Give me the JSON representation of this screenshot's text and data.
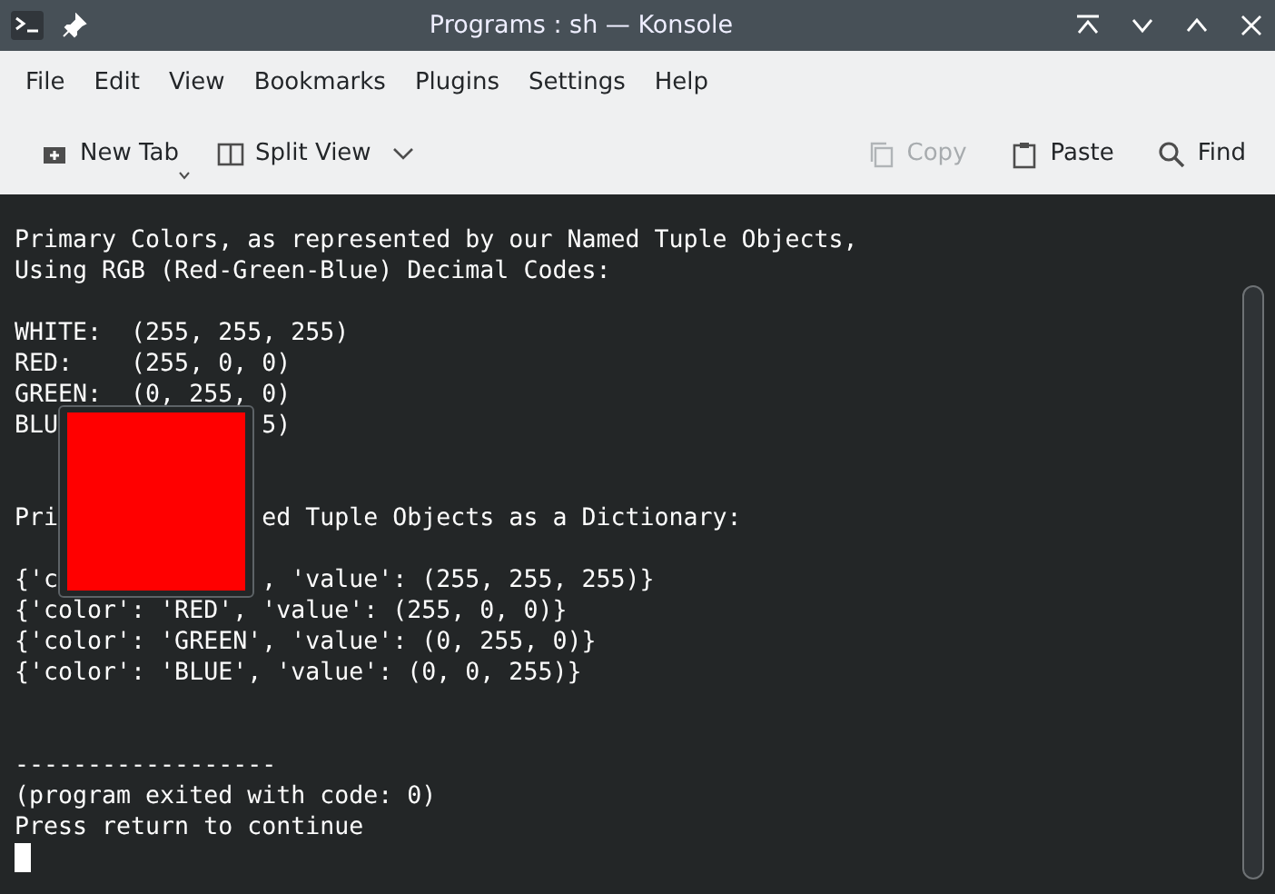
{
  "window": {
    "title": "Programs : sh — Konsole"
  },
  "menu": [
    "File",
    "Edit",
    "View",
    "Bookmarks",
    "Plugins",
    "Settings",
    "Help"
  ],
  "toolbar": {
    "left": [
      {
        "label": "New Tab",
        "kind": "newtab",
        "disabled": false
      },
      {
        "label": "Split View",
        "kind": "split",
        "disabled": false
      }
    ],
    "right": [
      {
        "label": "Copy",
        "kind": "copy",
        "disabled": true
      },
      {
        "label": "Paste",
        "kind": "paste",
        "disabled": false
      },
      {
        "label": "Find",
        "kind": "find",
        "disabled": false
      }
    ]
  },
  "terminal": {
    "blocks": [
      {
        "kind": "heading",
        "lines": [
          "Primary Colors, as represented by our Named Tuple Objects,",
          "Using RGB (Red-Green-Blue) Decimal Codes:"
        ]
      },
      {
        "kind": "table",
        "lines": [
          "WHITE:  (255, 255, 255)",
          "RED:    (255, 0, 0)",
          "GREEN:  (0, 255, 0)",
          "BLU              5)"
        ]
      },
      {
        "kind": "heading",
        "lines": [
          "Pri              ed Tuple Objects as a Dictionary:"
        ]
      },
      {
        "kind": "table",
        "lines": [
          "{'c              , 'value': (255, 255, 255)}",
          "{'color': 'RED', 'value': (255, 0, 0)}",
          "{'color': 'GREEN', 'value': (0, 255, 0)}",
          "{'color': 'BLUE', 'value': (0, 0, 255)}"
        ]
      },
      {
        "kind": "footer",
        "lines": [
          "------------------",
          "(program exited with code: 0)",
          "Press return to continue"
        ]
      }
    ],
    "cursor": true,
    "swatch": {
      "color": "#ff0000"
    }
  }
}
